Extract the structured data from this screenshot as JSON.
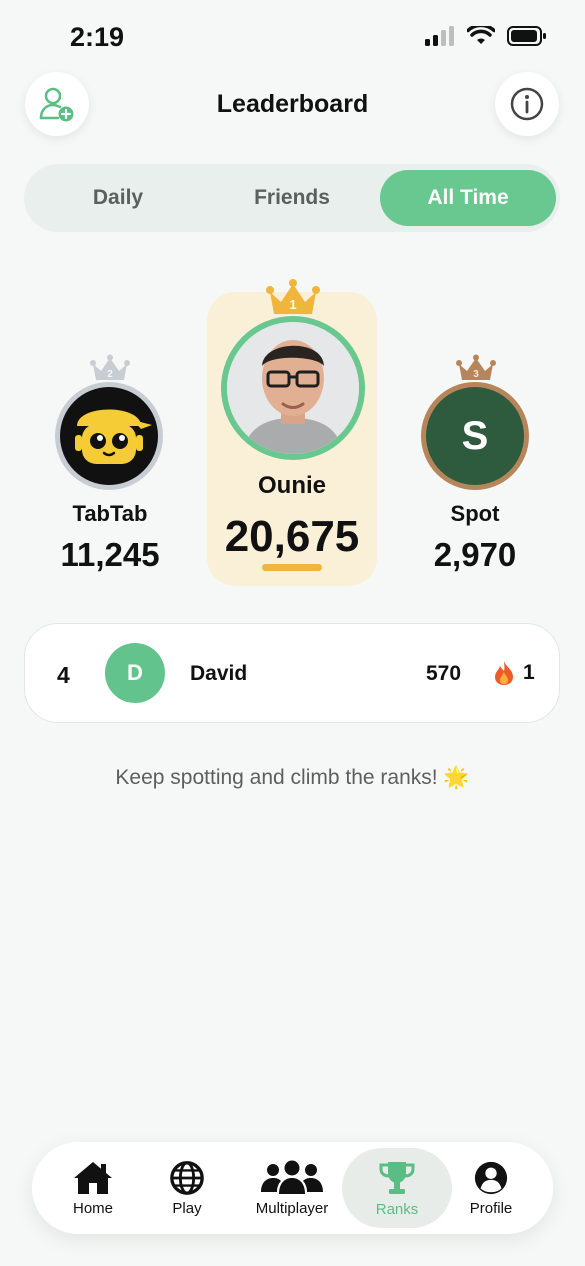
{
  "status": {
    "time": "2:19"
  },
  "header": {
    "title": "Leaderboard"
  },
  "tabs": [
    {
      "label": "Daily",
      "active": false
    },
    {
      "label": "Friends",
      "active": false
    },
    {
      "label": "All Time",
      "active": true
    }
  ],
  "podium": {
    "first": {
      "rank": "1",
      "name": "Ounie",
      "score": "20,675"
    },
    "second": {
      "rank": "2",
      "name": "TabTab",
      "score": "11,245"
    },
    "third": {
      "rank": "3",
      "name": "Spot",
      "score": "2,970",
      "initial": "S"
    }
  },
  "list": [
    {
      "rank": "4",
      "initial": "D",
      "name": "David",
      "score": "570",
      "streak": "1"
    }
  ],
  "encourage_text": "Keep spotting and climb the ranks! 🌟",
  "nav": [
    {
      "label": "Home",
      "icon": "home-icon"
    },
    {
      "label": "Play",
      "icon": "globe-icon"
    },
    {
      "label": "Multiplayer",
      "icon": "group-icon"
    },
    {
      "label": "Ranks",
      "icon": "trophy-icon",
      "active": true
    },
    {
      "label": "Profile",
      "icon": "person-icon"
    }
  ],
  "colors": {
    "accent": "#69c88f",
    "gold": "#f0b53a",
    "silver": "#c8cdd3",
    "bronze": "#b7855a",
    "spot_bg": "#2e5a3e"
  }
}
